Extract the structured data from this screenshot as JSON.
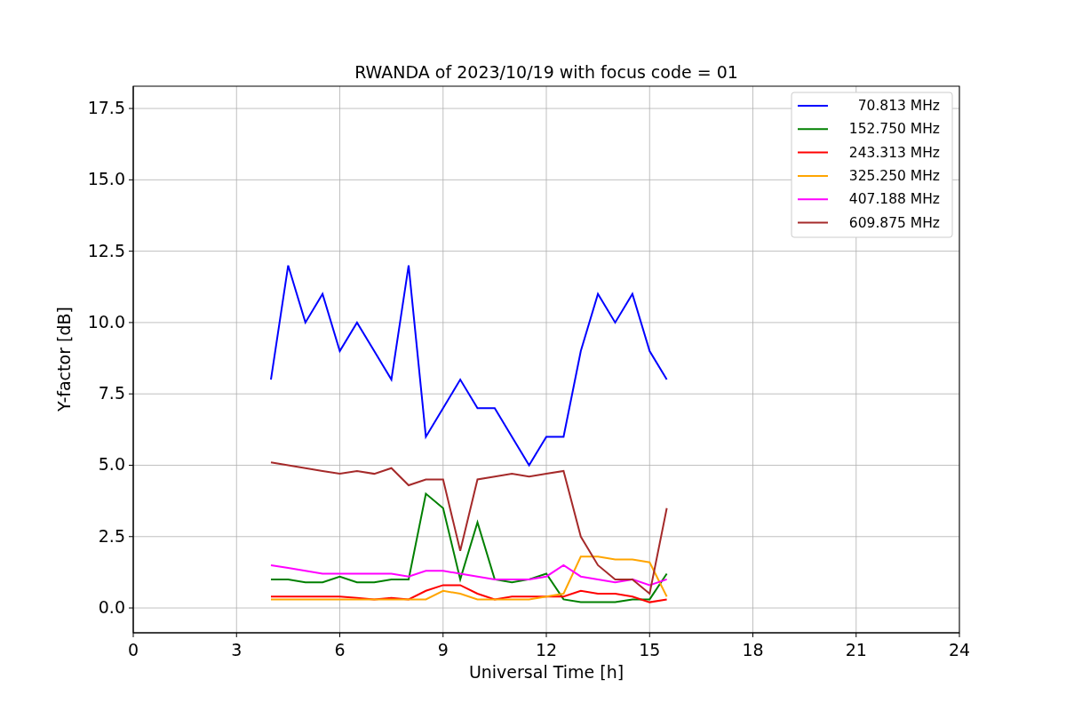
{
  "chart_data": {
    "type": "line",
    "title": "RWANDA of 2023/10/19 with focus code = 01",
    "xlabel": "Universal Time [h]",
    "ylabel": "Y-factor [dB]",
    "x": [
      4,
      4.5,
      5,
      5.5,
      6,
      6.5,
      7,
      7.5,
      8,
      8.5,
      9,
      9.5,
      10,
      10.5,
      11,
      11.5,
      12,
      12.5,
      13,
      13.5,
      14,
      14.5,
      15,
      15.5
    ],
    "series": [
      {
        "name": "70.813 MHz",
        "color": "#0000ff",
        "values": [
          8,
          12,
          10,
          11,
          9,
          10,
          9,
          8,
          12,
          6,
          7,
          8,
          7,
          7,
          6,
          5,
          6,
          6,
          9,
          11,
          10,
          11,
          9,
          8
        ]
      },
      {
        "name": "152.750 MHz",
        "color": "#008000",
        "values": [
          1.0,
          1.0,
          0.9,
          0.9,
          1.1,
          0.9,
          0.9,
          1.0,
          1.0,
          4,
          3.5,
          1.0,
          3,
          1.0,
          0.9,
          1.0,
          1.2,
          0.3,
          0.2,
          0.2,
          0.2,
          0.3,
          0.3,
          1.2
        ]
      },
      {
        "name": "243.313 MHz",
        "color": "#ff0000",
        "values": [
          0.4,
          0.4,
          0.4,
          0.4,
          0.4,
          0.35,
          0.3,
          0.35,
          0.3,
          0.6,
          0.8,
          0.8,
          0.5,
          0.3,
          0.4,
          0.4,
          0.4,
          0.4,
          0.6,
          0.5,
          0.5,
          0.4,
          0.2,
          0.3
        ]
      },
      {
        "name": "325.250 MHz",
        "color": "#ffa500",
        "values": [
          0.3,
          0.3,
          0.3,
          0.3,
          0.3,
          0.3,
          0.3,
          0.3,
          0.3,
          0.3,
          0.6,
          0.5,
          0.3,
          0.3,
          0.3,
          0.3,
          0.4,
          0.5,
          1.8,
          1.8,
          1.7,
          1.7,
          1.6,
          0.4
        ]
      },
      {
        "name": "407.188 MHz",
        "color": "#ff00ff",
        "values": [
          1.5,
          1.4,
          1.3,
          1.2,
          1.2,
          1.2,
          1.2,
          1.2,
          1.1,
          1.3,
          1.3,
          1.2,
          1.1,
          1.0,
          1.0,
          1.0,
          1.1,
          1.5,
          1.1,
          1.0,
          0.9,
          1.0,
          0.8,
          1.0
        ]
      },
      {
        "name": "609.875 MHz",
        "color": "#a52a2a",
        "values": [
          5.1,
          5.0,
          4.9,
          4.8,
          4.7,
          4.8,
          4.7,
          4.9,
          4.3,
          4.5,
          4.5,
          2.0,
          4.5,
          4.6,
          4.7,
          4.6,
          4.7,
          4.8,
          2.5,
          1.5,
          1.0,
          1.0,
          0.5,
          3.5
        ]
      }
    ],
    "xlim": [
      0,
      24
    ],
    "ylim": [
      -0.87,
      18.28
    ],
    "grid": true,
    "legend": true,
    "xticks": [
      0,
      3,
      6,
      9,
      12,
      15,
      18,
      21,
      24
    ],
    "yticks": [
      {
        "value": 0,
        "label": "0.0"
      },
      {
        "value": 2.5,
        "label": "2.5"
      },
      {
        "value": 5,
        "label": "5.0"
      },
      {
        "value": 7.5,
        "label": "7.5"
      },
      {
        "value": 10,
        "label": "10.0"
      },
      {
        "value": 12.5,
        "label": "12.5"
      },
      {
        "value": 15,
        "label": "15.0"
      },
      {
        "value": 17.5,
        "label": "17.5"
      }
    ]
  }
}
